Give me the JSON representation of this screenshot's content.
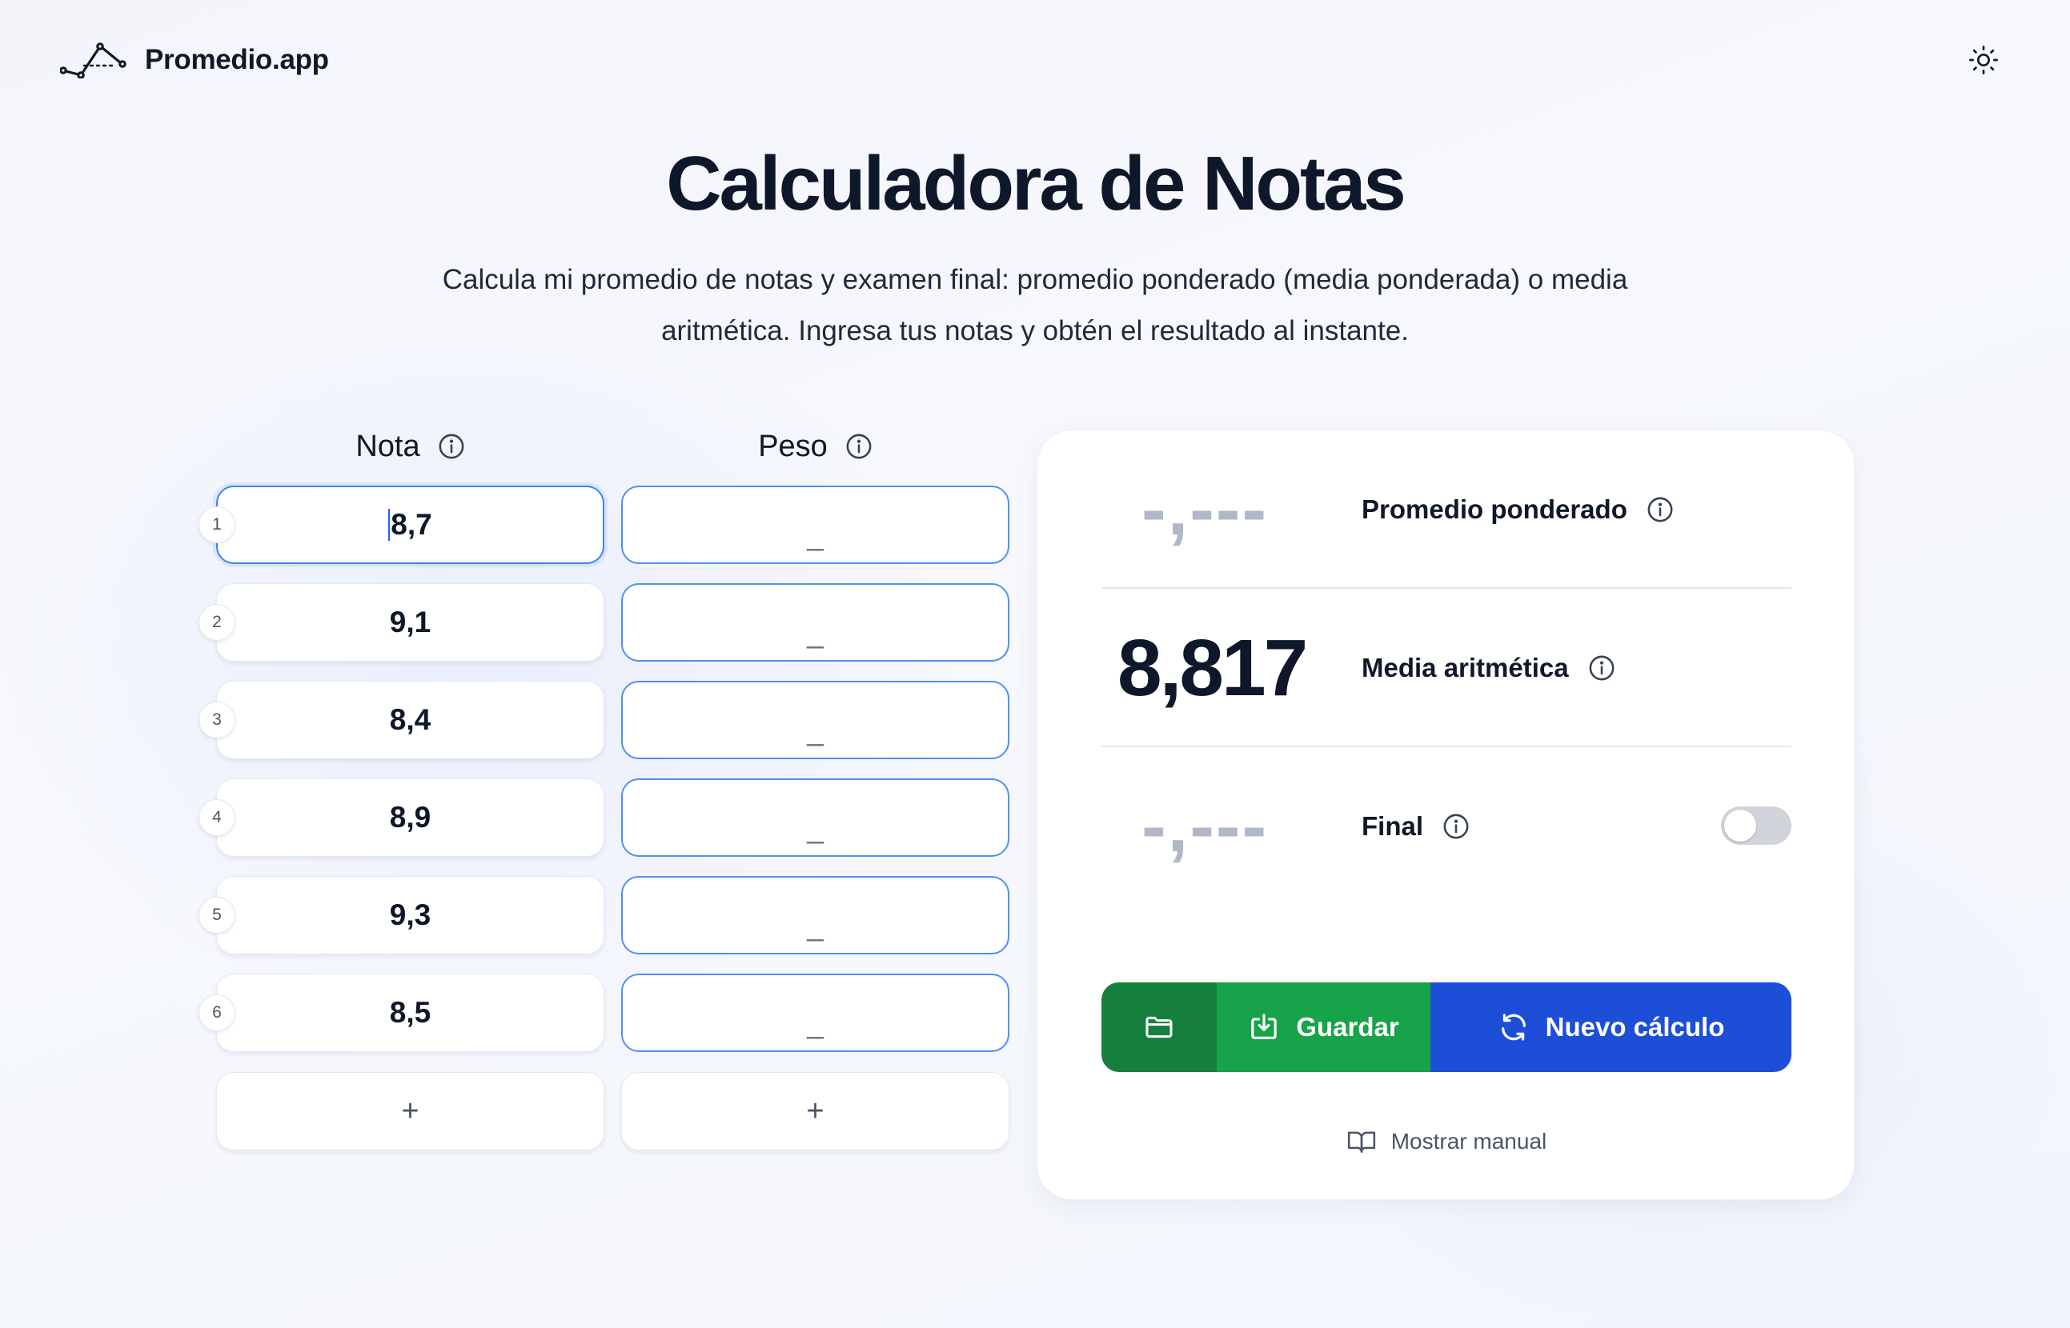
{
  "header": {
    "brand": "Promedio.app",
    "logo_icon": "chart-line-icon",
    "theme_icon": "sun-icon"
  },
  "hero": {
    "title": "Calculadora de Notas",
    "subtitle": "Calcula mi promedio de notas y examen final: promedio ponderado (media ponderada) o media aritmética. Ingresa tus notas y obtén el resultado al instante."
  },
  "table": {
    "nota_header": "Nota",
    "peso_header": "Peso",
    "info_icon": "info-icon",
    "rows": [
      {
        "index": "1",
        "nota": "8,7",
        "peso": "_"
      },
      {
        "index": "2",
        "nota": "9,1",
        "peso": "_"
      },
      {
        "index": "3",
        "nota": "8,4",
        "peso": "_"
      },
      {
        "index": "4",
        "nota": "8,9",
        "peso": "_"
      },
      {
        "index": "5",
        "nota": "9,3",
        "peso": "_"
      },
      {
        "index": "6",
        "nota": "8,5",
        "peso": "_"
      }
    ],
    "add_label": "+"
  },
  "results": {
    "ponderado": {
      "value": "-,---",
      "label": "Promedio ponderado"
    },
    "aritmetica": {
      "value": "8,817",
      "label": "Media aritmética"
    },
    "final": {
      "value": "-,---",
      "label": "Final",
      "toggle_on": false
    }
  },
  "actions": {
    "folder_icon": "folder-icon",
    "save_label": "Guardar",
    "save_icon": "download-icon",
    "new_label": "Nuevo cálculo",
    "new_icon": "refresh-icon"
  },
  "manual": {
    "label": "Mostrar manual",
    "icon": "book-icon"
  },
  "colors": {
    "focus_blue": "#3b82f6",
    "save_green": "#16a34a",
    "folder_green": "#15803d",
    "new_blue": "#1d4ed8"
  }
}
